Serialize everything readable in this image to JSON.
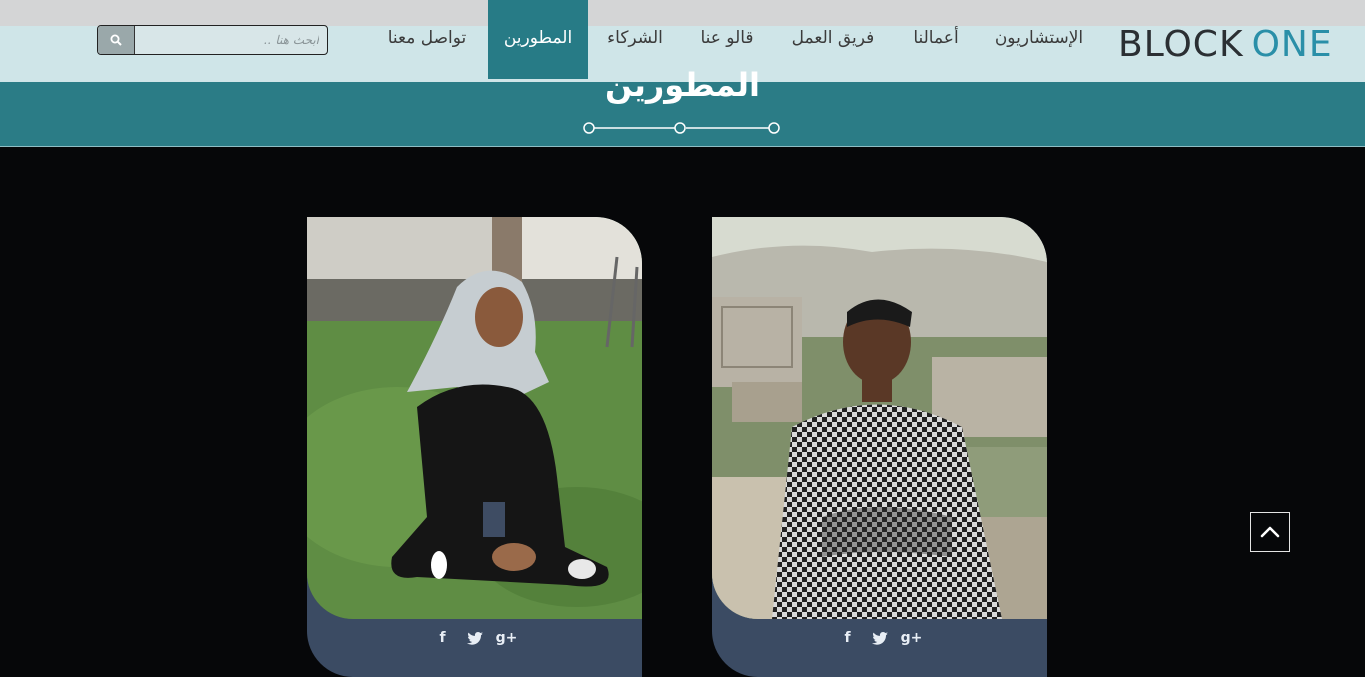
{
  "logo": {
    "part1": "BLOCK",
    "part2": "ONE"
  },
  "nav": {
    "items": [
      {
        "label": "الإستشاريون",
        "active": false
      },
      {
        "label": "أعمالنا",
        "active": false
      },
      {
        "label": "فريق العمل",
        "active": false
      },
      {
        "label": "قالو عنا",
        "active": false
      },
      {
        "label": "الشركاء",
        "active": false
      },
      {
        "label": "المطورين",
        "active": true
      },
      {
        "label": "تواصل معنا",
        "active": false
      }
    ]
  },
  "search": {
    "placeholder": "ابحث هنا ..",
    "icon": "search-icon"
  },
  "page": {
    "title": "المطورين"
  },
  "colors": {
    "accent": "#277b86",
    "band": "#2b7c86",
    "card_footer": "#3b4b63",
    "background": "#060709"
  },
  "cards": [
    {
      "socials": [
        "facebook-icon",
        "twitter-icon",
        "google-plus-icon"
      ]
    },
    {
      "socials": [
        "facebook-icon",
        "twitter-icon",
        "google-plus-icon"
      ]
    }
  ],
  "scroll_top": {
    "icon": "chevron-up-icon"
  }
}
